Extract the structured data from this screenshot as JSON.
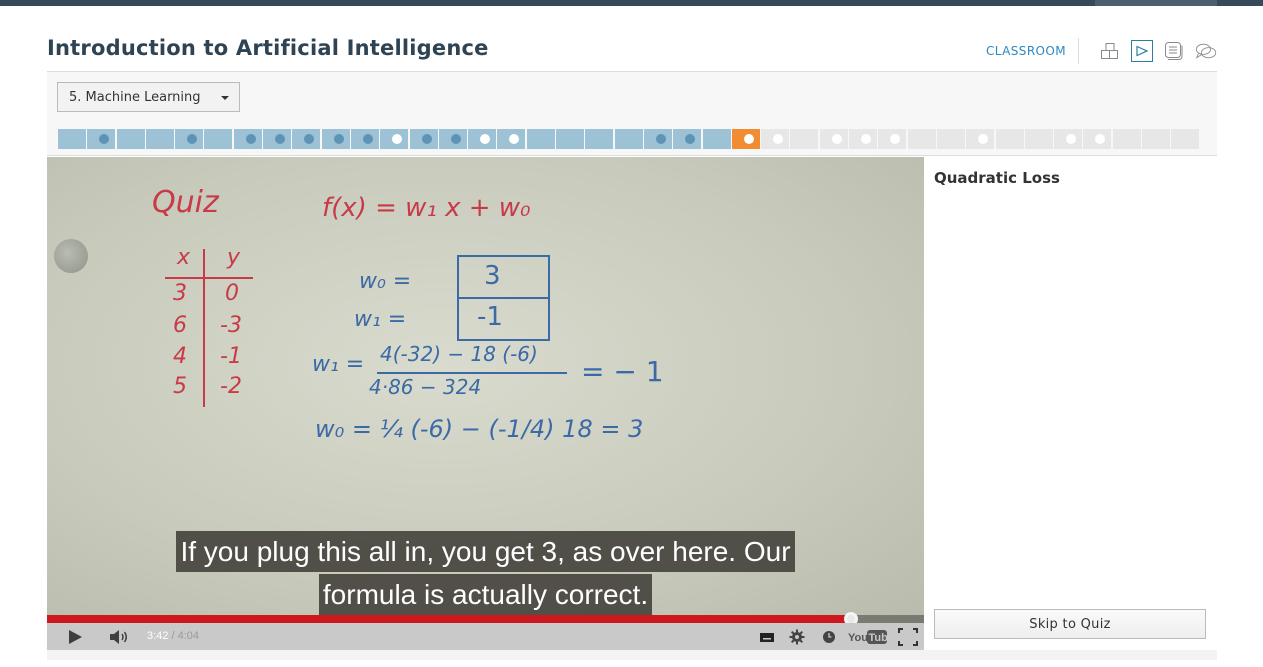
{
  "header": {
    "course_title": "Introduction to Artificial Intelligence",
    "classroom_label": "CLASSROOM",
    "nav_icons": [
      "course-map-icon",
      "video-icon",
      "notes-icon",
      "forum-icon"
    ],
    "active_nav": "video-icon"
  },
  "lesson_selector": {
    "selected": "5. Machine Learning"
  },
  "progress": {
    "segments": [
      {
        "state": "watched",
        "dot": "none"
      },
      {
        "state": "watched",
        "dot": "dark"
      },
      {
        "state": "watched",
        "dot": "none"
      },
      {
        "state": "watched",
        "dot": "none"
      },
      {
        "state": "watched",
        "dot": "dark"
      },
      {
        "state": "watched",
        "dot": "none"
      },
      {
        "state": "watched",
        "dot": "dark"
      },
      {
        "state": "watched",
        "dot": "dark"
      },
      {
        "state": "watched",
        "dot": "dark"
      },
      {
        "state": "watched",
        "dot": "dark"
      },
      {
        "state": "watched",
        "dot": "dark"
      },
      {
        "state": "watched",
        "dot": "light"
      },
      {
        "state": "watched",
        "dot": "dark"
      },
      {
        "state": "watched",
        "dot": "dark"
      },
      {
        "state": "watched",
        "dot": "light"
      },
      {
        "state": "watched",
        "dot": "light"
      },
      {
        "state": "watched",
        "dot": "none"
      },
      {
        "state": "watched",
        "dot": "none"
      },
      {
        "state": "watched",
        "dot": "none"
      },
      {
        "state": "watched",
        "dot": "none"
      },
      {
        "state": "watched",
        "dot": "dark"
      },
      {
        "state": "watched",
        "dot": "dark"
      },
      {
        "state": "watched",
        "dot": "none"
      },
      {
        "state": "current",
        "dot": "light"
      },
      {
        "state": "future",
        "dot": "light"
      },
      {
        "state": "future",
        "dot": "none"
      },
      {
        "state": "future",
        "dot": "light"
      },
      {
        "state": "future",
        "dot": "light"
      },
      {
        "state": "future",
        "dot": "light"
      },
      {
        "state": "future",
        "dot": "none"
      },
      {
        "state": "future",
        "dot": "none"
      },
      {
        "state": "future",
        "dot": "light"
      },
      {
        "state": "future",
        "dot": "none"
      },
      {
        "state": "future",
        "dot": "none"
      },
      {
        "state": "future",
        "dot": "light"
      },
      {
        "state": "future",
        "dot": "light"
      },
      {
        "state": "future",
        "dot": "none"
      },
      {
        "state": "future",
        "dot": "none"
      },
      {
        "state": "future",
        "dot": "none"
      }
    ]
  },
  "video": {
    "whiteboard": {
      "quiz_label": "Quiz",
      "formula": "f(x) = w₁ x + w₀",
      "table_headers": [
        "x",
        "y"
      ],
      "table_rows": [
        [
          "3",
          "0"
        ],
        [
          "6",
          "-3"
        ],
        [
          "4",
          "-1"
        ],
        [
          "5",
          "-2"
        ]
      ],
      "w0_label": "w₀ =",
      "w0_box": "3",
      "w1_label": "w₁ =",
      "w1_box": "-1",
      "w1_calc_prefix": "w₁ =",
      "w1_numerator": "4(-32) − 18 (-6)",
      "w1_denominator": "4·86 − 324",
      "w1_result": "= − 1",
      "w0_calc": "w₀ = ¼ (-6) − (-1/4) 18 = 3"
    },
    "caption_lines": [
      "If you plug this all in, you get 3, as over here. Our",
      "formula is actually correct."
    ],
    "current_time": "3:42",
    "total_time": "/ 4:04",
    "played_fraction": 0.9163,
    "controls": {
      "play": "play-icon",
      "volume": "volume-icon",
      "captions": "captions-icon",
      "settings": "gear-icon",
      "watch_later": "clock-icon",
      "brand": "YouTube",
      "fullscreen": "fullscreen-icon"
    }
  },
  "sidebar": {
    "title": "Quadratic Loss",
    "skip_button": "Skip to Quiz"
  }
}
